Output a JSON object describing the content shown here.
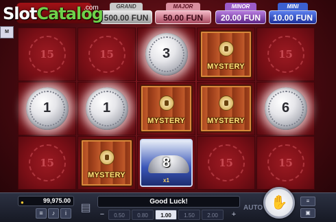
{
  "watermark": {
    "part1": "Slot",
    "part2": "Catalog",
    "suffix": ".com"
  },
  "side_tab": {
    "label": "M"
  },
  "jackpots": [
    {
      "label": "GRAND",
      "value": "500.00 FUN"
    },
    {
      "label": "MAJOR",
      "value": "50.00 FUN"
    },
    {
      "label": "MINOR",
      "value": "20.00 FUN"
    },
    {
      "label": "MINI",
      "value": "10.00 FUN"
    }
  ],
  "grid": {
    "empty_emblem": "15",
    "coins": [
      {
        "value": "3"
      },
      {
        "value": "1"
      },
      {
        "value": "1"
      },
      {
        "value": "6"
      }
    ],
    "mystery_label": "MYSTERY",
    "special_chest": {
      "value": "8",
      "multiplier": "x1"
    }
  },
  "bottom": {
    "balance": "99,975.00",
    "message": "Good Luck!",
    "bets": [
      "0.50",
      "0.80",
      "1.00",
      "1.50",
      "2.00"
    ],
    "selected_bet": "1.00",
    "auto_label": "AUTO",
    "icons": [
      "coin-icon",
      "menu-icon",
      "sound-icon",
      "info-icon",
      "basket-icon",
      "minus-icon",
      "plus-icon",
      "hand-icon",
      "settings-icon"
    ]
  }
}
